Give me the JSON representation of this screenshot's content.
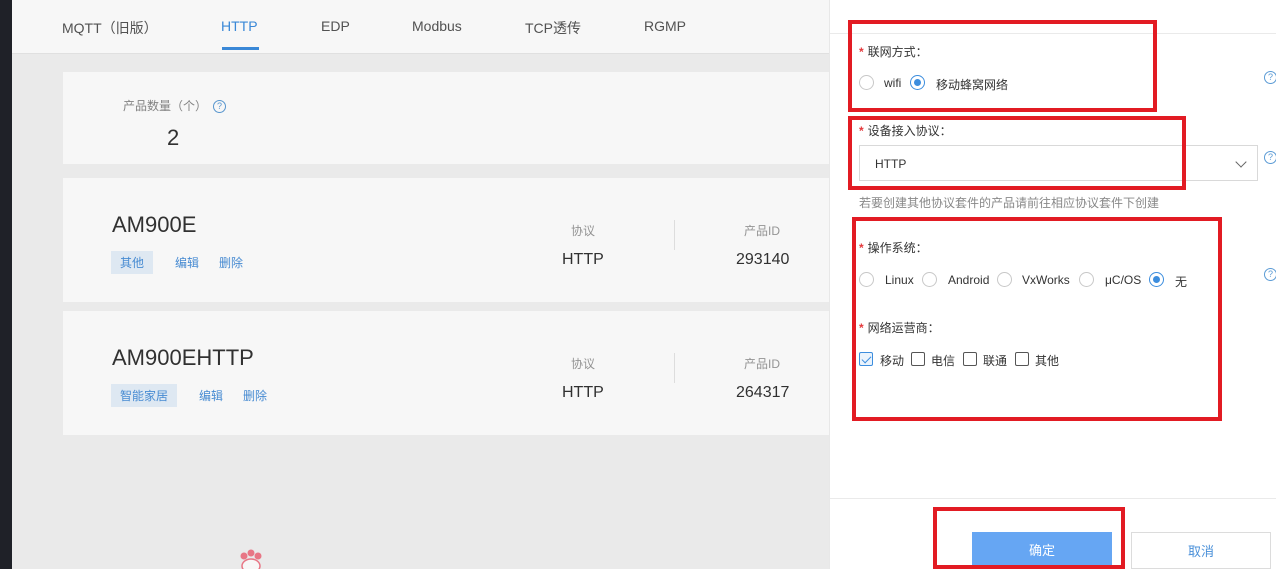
{
  "tabs": [
    {
      "label": "MQTT（旧版）",
      "active": false
    },
    {
      "label": "HTTP",
      "active": true
    },
    {
      "label": "EDP",
      "active": false
    },
    {
      "label": "Modbus",
      "active": false
    },
    {
      "label": "TCP透传",
      "active": false
    },
    {
      "label": "RGMP",
      "active": false
    }
  ],
  "summary": {
    "label": "产品数量（个）",
    "value": "2"
  },
  "products": [
    {
      "name": "AM900E",
      "tag": "其他",
      "edit": "编辑",
      "delete": "删除",
      "protocol_label": "协议",
      "protocol": "HTTP",
      "id_label": "产品ID",
      "id": "293140"
    },
    {
      "name": "AM900EHTTP",
      "tag": "智能家居",
      "edit": "编辑",
      "delete": "删除",
      "protocol_label": "协议",
      "protocol": "HTTP",
      "id_label": "产品ID",
      "id": "264317"
    }
  ],
  "form": {
    "network": {
      "label": "联网方式：",
      "options": [
        "wifi",
        "移动蜂窝网络"
      ],
      "selected": "移动蜂窝网络"
    },
    "protocol": {
      "label": "设备接入协议：",
      "value": "HTTP",
      "hint": "若要创建其他协议套件的产品请前往相应协议套件下创建"
    },
    "os": {
      "label": "操作系统：",
      "options": [
        "Linux",
        "Android",
        "VxWorks",
        "μC/OS",
        "无"
      ],
      "selected": "无"
    },
    "carrier": {
      "label": "网络运营商：",
      "options": [
        "移动",
        "电信",
        "联通",
        "其他"
      ],
      "checked": [
        "移动"
      ]
    },
    "help_symbol": "?",
    "required_mark": "*"
  },
  "buttons": {
    "confirm": "确定",
    "cancel": "取消"
  },
  "colors": {
    "accent": "#3c8dde",
    "highlight": "#e21b23",
    "primary_button": "#66a6f3"
  }
}
